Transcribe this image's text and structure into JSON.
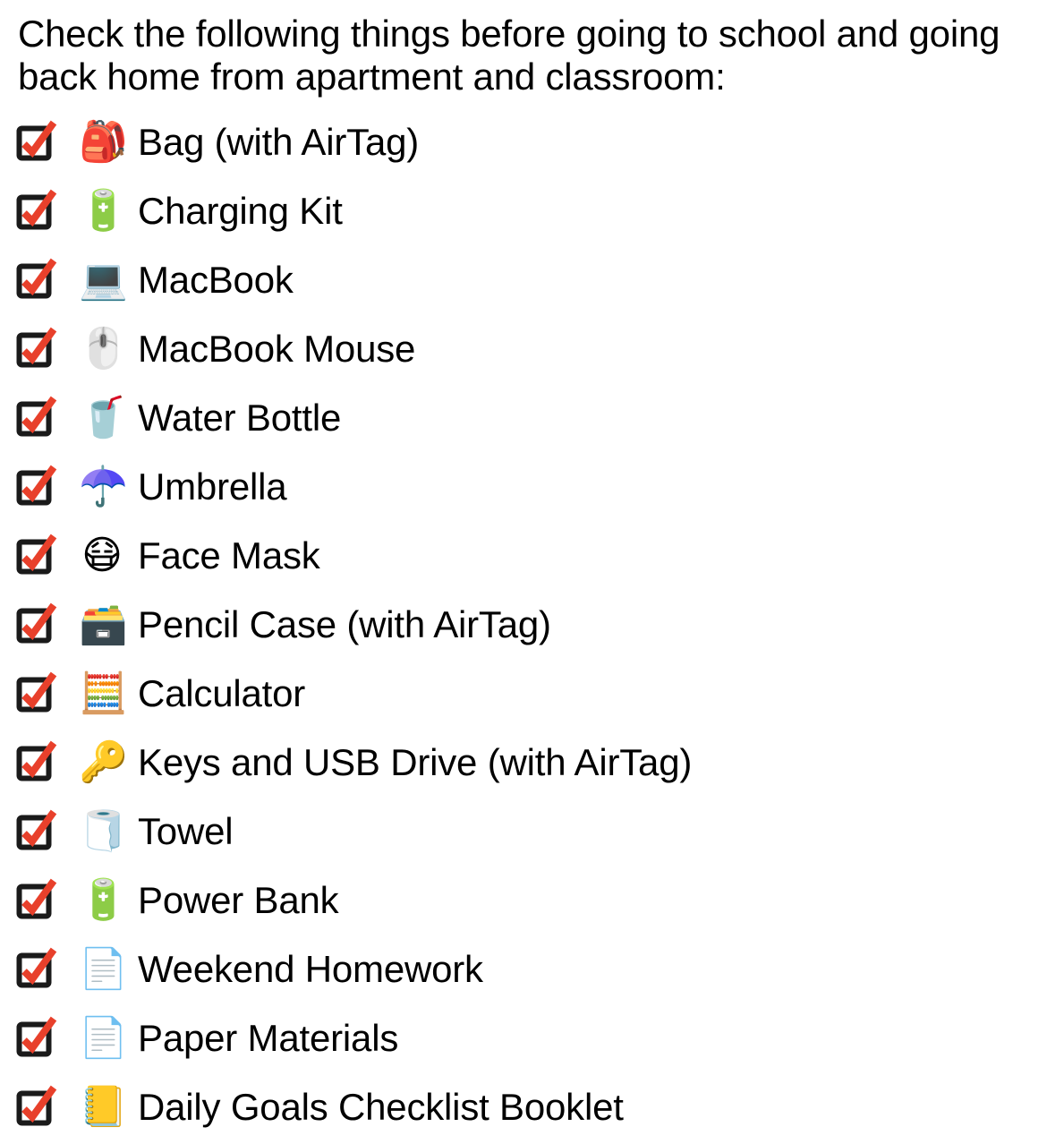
{
  "document": {
    "heading": "Check the following things before going to school and going back home from apartment and classroom:",
    "checkbox_box_color": "#1a1a1a",
    "checkbox_check_color": "#e8402b"
  },
  "checklist": {
    "items": [
      {
        "checked": true,
        "checkbox": "ballot-box-with-check-icon",
        "emoji": "🎒",
        "emoji_name": "backpack-icon",
        "label": "Bag (with AirTag)"
      },
      {
        "checked": true,
        "checkbox": "ballot-box-with-check-icon",
        "emoji": "🔋",
        "emoji_name": "battery-icon",
        "label": "Charging Kit"
      },
      {
        "checked": true,
        "checkbox": "ballot-box-with-check-icon",
        "emoji": "💻",
        "emoji_name": "laptop-icon",
        "label": "MacBook"
      },
      {
        "checked": true,
        "checkbox": "ballot-box-with-check-icon",
        "emoji": "🖱️",
        "emoji_name": "computer-mouse-icon",
        "label": "MacBook Mouse"
      },
      {
        "checked": true,
        "checkbox": "ballot-box-with-check-icon",
        "emoji": "🥤",
        "emoji_name": "cup-with-straw-icon",
        "label": "Water Bottle"
      },
      {
        "checked": true,
        "checkbox": "ballot-box-with-check-icon",
        "emoji": "☂️",
        "emoji_name": "umbrella-icon",
        "label": "Umbrella"
      },
      {
        "checked": true,
        "checkbox": "ballot-box-with-check-icon",
        "emoji": "😷",
        "emoji_name": "face-with-medical-mask-icon",
        "label": "Face Mask"
      },
      {
        "checked": true,
        "checkbox": "ballot-box-with-check-icon",
        "emoji": "🗃️",
        "emoji_name": "card-file-box-icon",
        "label": "Pencil Case (with AirTag)"
      },
      {
        "checked": true,
        "checkbox": "ballot-box-with-check-icon",
        "emoji": "🧮",
        "emoji_name": "abacus-icon",
        "label": "Calculator"
      },
      {
        "checked": true,
        "checkbox": "ballot-box-with-check-icon",
        "emoji": "🔑",
        "emoji_name": "key-icon",
        "label": "Keys and USB Drive (with AirTag)"
      },
      {
        "checked": true,
        "checkbox": "ballot-box-with-check-icon",
        "emoji": "🧻",
        "emoji_name": "roll-of-paper-icon",
        "label": "Towel"
      },
      {
        "checked": true,
        "checkbox": "ballot-box-with-check-icon",
        "emoji": "🔋",
        "emoji_name": "battery-icon",
        "label": "Power Bank"
      },
      {
        "checked": true,
        "checkbox": "ballot-box-with-check-icon",
        "emoji": "📄",
        "emoji_name": "page-facing-up-icon",
        "label": "Weekend Homework"
      },
      {
        "checked": true,
        "checkbox": "ballot-box-with-check-icon",
        "emoji": "📄",
        "emoji_name": "page-facing-up-icon",
        "label": "Paper Materials"
      },
      {
        "checked": true,
        "checkbox": "ballot-box-with-check-icon",
        "emoji": "📒",
        "emoji_name": "ledger-notebook-icon",
        "label": "Daily Goals Checklist Booklet"
      }
    ]
  }
}
